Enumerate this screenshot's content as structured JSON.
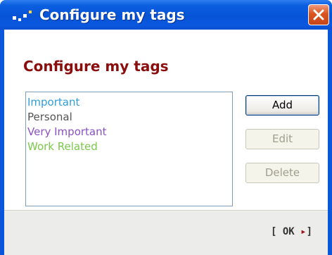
{
  "window": {
    "title": "Configure my tags"
  },
  "dialog": {
    "heading": "Configure my tags",
    "tags": [
      {
        "label": "Important",
        "color": "#2f9fd6"
      },
      {
        "label": "Personal",
        "color": "#555555"
      },
      {
        "label": "Very Important",
        "color": "#8a52c4"
      },
      {
        "label": "Work Related",
        "color": "#7ac94a"
      }
    ],
    "buttons": {
      "add": "Add",
      "edit": "Edit",
      "delete": "Delete"
    }
  },
  "footer": {
    "ok_open": "[",
    "ok_label": "OK",
    "ok_arrow": "▸",
    "ok_close": "]"
  },
  "icons": {
    "app": "tag-dots-icon",
    "close": "close-icon"
  },
  "colors": {
    "titlebar": "#0653d6",
    "heading": "#8b0e0e",
    "close": "#d9541f"
  }
}
